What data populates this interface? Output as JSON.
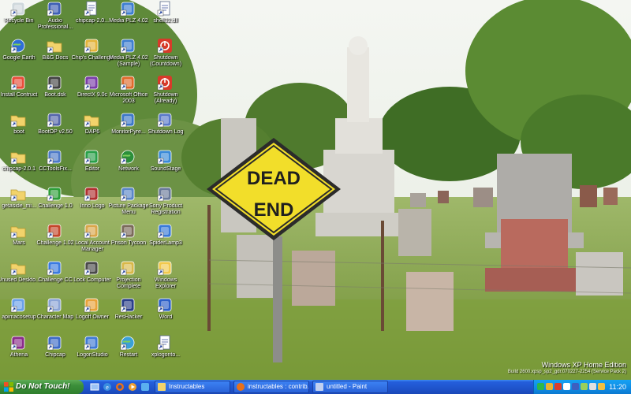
{
  "desktop": {
    "icons": [
      {
        "label": "Recycle Bin",
        "icon": "recycle-bin-icon",
        "color": "#cfd8dc"
      },
      {
        "label": "Google Earth",
        "icon": "google-earth-icon",
        "color": "#2f6fd6"
      },
      {
        "label": "Install Contruct",
        "icon": "install-construct-icon",
        "color": "#e84d3a"
      },
      {
        "label": "boot",
        "icon": "folder-icon",
        "color": "#f2d36b"
      },
      {
        "label": "chipcap-2.0.1",
        "icon": "folder-icon",
        "color": "#f2d36b"
      },
      {
        "label": "getaside_mi...",
        "icon": "folder-icon",
        "color": "#f2d36b"
      },
      {
        "label": "Mars",
        "icon": "folder-icon",
        "color": "#f2d36b"
      },
      {
        "label": "Unused Deskto...",
        "icon": "folder-icon",
        "color": "#f2d36b"
      },
      {
        "label": "apimacosetup",
        "icon": "setup-icon",
        "color": "#6aa0e8"
      },
      {
        "label": "Athena",
        "icon": "athena-icon",
        "color": "#8a2c8a"
      },
      {
        "label": "Audio Professional...",
        "icon": "audio-professional-icon",
        "color": "#3e5fb5"
      },
      {
        "label": "B&G Docs",
        "icon": "folder-icon",
        "color": "#f2d36b"
      },
      {
        "label": "Boot.dsk",
        "icon": "boot-dsk-icon",
        "color": "#444444"
      },
      {
        "label": "BootOP v2.50",
        "icon": "bootop-icon",
        "color": "#5566aa"
      },
      {
        "label": "CCToolsFix...",
        "icon": "cctools-icon",
        "color": "#4d7ac8"
      },
      {
        "label": "Challenge 1.0",
        "icon": "challenge-icon",
        "color": "#2e9e3a"
      },
      {
        "label": "Challenge 1.02",
        "icon": "challenge-icon",
        "color": "#c4472a"
      },
      {
        "label": "Challenge CC",
        "icon": "challenge-icon",
        "color": "#3b7be0"
      },
      {
        "label": "Character Map",
        "icon": "character-map-icon",
        "color": "#8aa4d6"
      },
      {
        "label": "Chipcap",
        "icon": "chipcap-icon",
        "color": "#3d6bc6"
      },
      {
        "label": "chipcap-2.0...",
        "icon": "shortcut-icon",
        "color": "#9fb7e6"
      },
      {
        "label": "Chip's Challenge",
        "icon": "chips-challenge-icon",
        "color": "#e3b43b"
      },
      {
        "label": "DirectX 9.0c",
        "icon": "directx-icon",
        "color": "#7a3da8"
      },
      {
        "label": "DAP6",
        "icon": "folder-icon",
        "color": "#f2d36b"
      },
      {
        "label": "Editor",
        "icon": "editor-icon",
        "color": "#2aa04a"
      },
      {
        "label": "Inno Logo",
        "icon": "inno-logo-icon",
        "color": "#b03030"
      },
      {
        "label": "Local Account Manager",
        "icon": "account-manager-icon",
        "color": "#d9a64a"
      },
      {
        "label": "Lock Computer",
        "icon": "lock-computer-icon",
        "color": "#4a4a4a"
      },
      {
        "label": "Logoff Owner",
        "icon": "logoff-icon",
        "color": "#e8a23a"
      },
      {
        "label": "LogonStudio",
        "icon": "logonstudio-icon",
        "color": "#3f7ad4"
      },
      {
        "label": "Media PLZ 4.02",
        "icon": "media-plz-icon",
        "color": "#3f7fd0"
      },
      {
        "label": "Media PLZ 4.02 (Sample)",
        "icon": "media-plz-icon",
        "color": "#3f7fd0"
      },
      {
        "label": "Microsoft Office 2003",
        "icon": "office-icon",
        "color": "#e06a2b"
      },
      {
        "label": "MonitorPyre...",
        "icon": "monitor-icon",
        "color": "#3d78c8"
      },
      {
        "label": "Network",
        "icon": "network-icon",
        "color": "#2b8f3a"
      },
      {
        "label": "Picture Package Menu",
        "icon": "picture-package-icon",
        "color": "#5a86c8"
      },
      {
        "label": "Prison Tycoon",
        "icon": "prison-tycoon-icon",
        "color": "#7b6a5a"
      },
      {
        "label": "Projection Complete",
        "icon": "projection-icon",
        "color": "#d8b84a"
      },
      {
        "label": "ResHacker",
        "icon": "reshacker-icon",
        "color": "#2a3f8a"
      },
      {
        "label": "Restart",
        "icon": "restart-icon",
        "color": "#3aa0d8"
      },
      {
        "label": "shell32.dll",
        "icon": "dll-icon",
        "color": "#c9d3e8"
      },
      {
        "label": "Shutdown (Countdown)",
        "icon": "shutdown-icon",
        "color": "#d83a2a"
      },
      {
        "label": "Shutdown (Already)",
        "icon": "shutdown-icon",
        "color": "#d83a2a"
      },
      {
        "label": "Shutdown Log",
        "icon": "shutdown-log-icon",
        "color": "#5a7ac8"
      },
      {
        "label": "SoundStage",
        "icon": "soundstage-icon",
        "color": "#3a8ad8"
      },
      {
        "label": "Sony Product Registration",
        "icon": "sony-registration-icon",
        "color": "#6a7a9a"
      },
      {
        "label": "SpiderLamp3",
        "icon": "spiderlamp-icon",
        "color": "#3a7ad8"
      },
      {
        "label": "Windows Explorer",
        "icon": "windows-explorer-icon",
        "color": "#f2c94c"
      },
      {
        "label": "Word",
        "icon": "word-icon",
        "color": "#2b5fc8"
      },
      {
        "label": "xplogonto...",
        "icon": "text-file-icon",
        "color": "#ffffff"
      }
    ]
  },
  "sign": {
    "line1": "DEAD",
    "line2": "END"
  },
  "watermark": {
    "edition": "Windows XP Home Edition",
    "build": "Build 2600.xpsp_sp2_gdr.070227-2254 (Service Pack 2)"
  },
  "taskbar": {
    "start_label": "Do Not Touch!",
    "tasks": [
      {
        "label": "Instructables",
        "icon": "folder-icon"
      },
      {
        "label": "instructables : contrib...",
        "icon": "firefox-icon"
      },
      {
        "label": "untitled - Paint",
        "icon": "paint-icon"
      }
    ],
    "clock": "11:20"
  },
  "colors": {
    "taskbar": "#245edb",
    "start": "#3c8f3a",
    "tray": "#0f8be4",
    "sign_yellow": "#f2de2a"
  }
}
